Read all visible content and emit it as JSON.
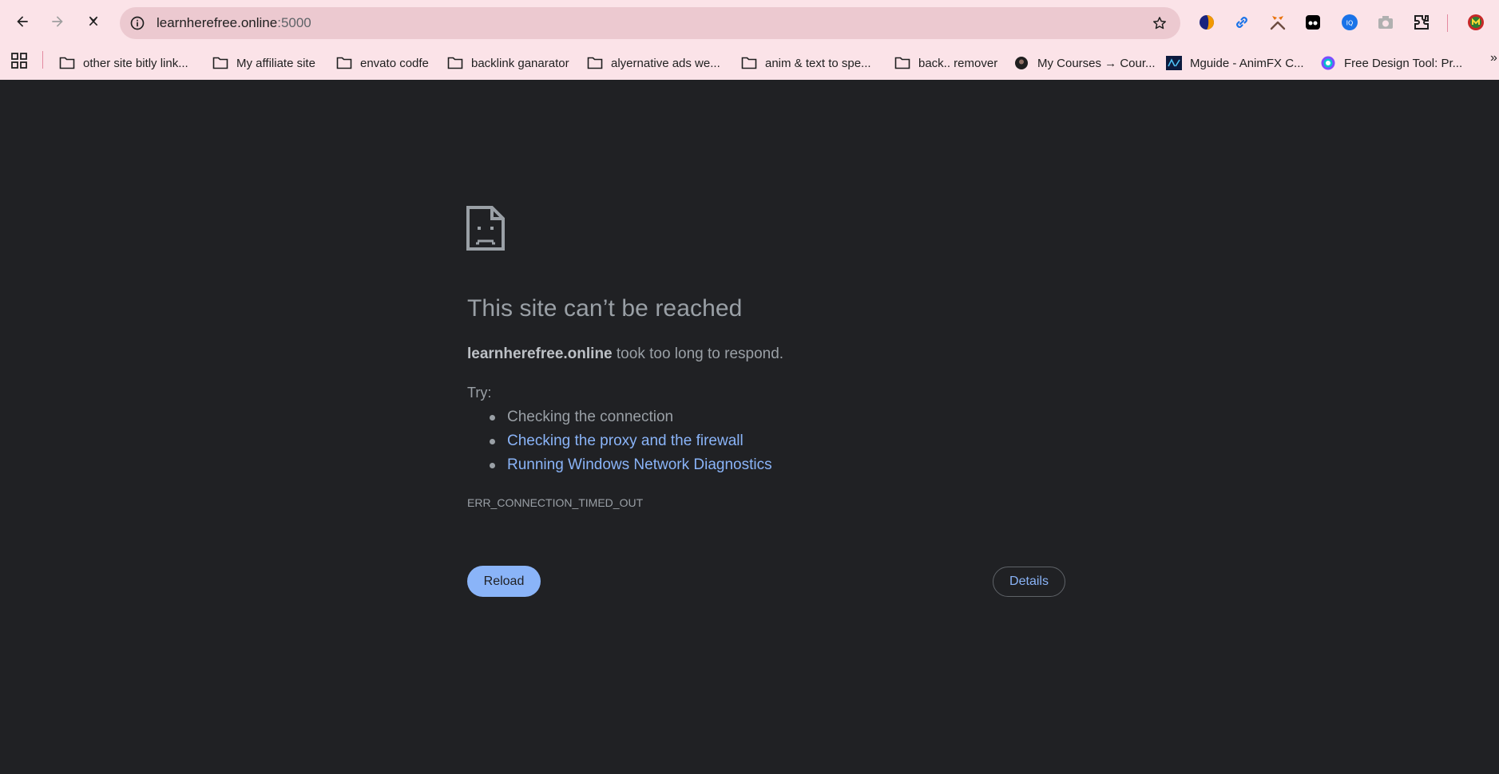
{
  "toolbar": {
    "back_icon": "arrow-left-icon",
    "forward_icon": "arrow-right-icon",
    "stop_icon": "close-icon",
    "url_host": "learnherefree.online",
    "url_port": ":5000",
    "info_icon": "info-icon",
    "star_icon": "star-icon"
  },
  "extensions": [
    {
      "name": "extension-1-icon",
      "color": "#f29900"
    },
    {
      "name": "link-icon",
      "color": "#1a73e8"
    },
    {
      "name": "tools-icon",
      "color": "#e8710a"
    },
    {
      "name": "extension-4-icon",
      "color": "#000000"
    },
    {
      "name": "extension-5-icon",
      "color": "#1a73e8"
    },
    {
      "name": "camera-icon",
      "color": "#9aa0a6"
    },
    {
      "name": "puzzle-icon",
      "color": "#1f1f1f"
    },
    {
      "name": "profile-avatar-icon",
      "color": "#d93025"
    }
  ],
  "bookmarks": [
    {
      "label": "other site bitly link...",
      "icon": "folder-icon"
    },
    {
      "label": "My affiliate site",
      "icon": "folder-icon"
    },
    {
      "label": "envato codfe",
      "icon": "folder-icon"
    },
    {
      "label": "backlink ganarator",
      "icon": "folder-icon"
    },
    {
      "label": "alyernative ads we...",
      "icon": "folder-icon"
    },
    {
      "label": "anim & text to spe...",
      "icon": "folder-icon"
    },
    {
      "label": "back.. remover",
      "icon": "folder-icon"
    },
    {
      "label": "My Courses → Cour...",
      "icon": "site-favicon-icon"
    },
    {
      "label": "Mguide - AnimFX C...",
      "icon": "site-favicon-icon"
    },
    {
      "label": "Free Design Tool: Pr...",
      "icon": "site-favicon-icon"
    }
  ],
  "error_page": {
    "title": "This site can’t be reached",
    "host": "learnherefree.online",
    "message_suffix": " took too long to respond.",
    "try_label": "Try:",
    "suggestions": [
      "Checking the connection",
      "Checking the proxy and the firewall",
      "Running Windows Network Diagnostics"
    ],
    "error_code": "ERR_CONNECTION_TIMED_OUT",
    "reload_label": "Reload",
    "details_label": "Details"
  },
  "colors": {
    "chrome_bg": "#fbe3e8",
    "omnibox_bg": "#ecc9d0",
    "page_bg": "#202124",
    "link": "#8ab4f8",
    "text": "#9aa0a6"
  }
}
